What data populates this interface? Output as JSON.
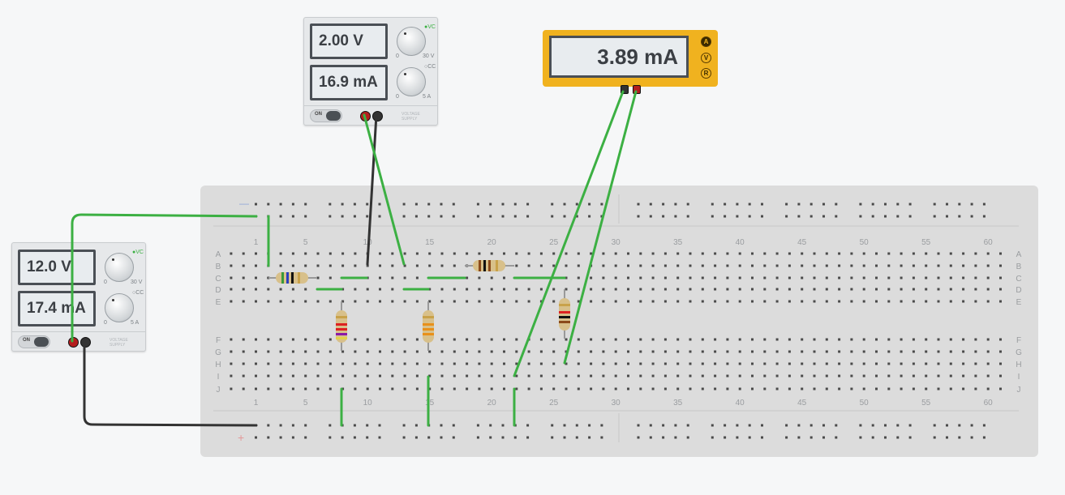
{
  "supply_top": {
    "voltage": "2.00 V",
    "current": "16.9 mA",
    "cv_label": "VC",
    "cc_label": "CC",
    "vmin": "0",
    "vmax": "30 V",
    "amin": "0",
    "amax": "5 A",
    "on_label": "ON",
    "brand": "VOLTAGE SUPPLY"
  },
  "supply_left": {
    "voltage": "12.0 V",
    "current": "17.4 mA",
    "cv_label": "VC",
    "cc_label": "CC",
    "vmin": "0",
    "vmax": "30 V",
    "amin": "0",
    "amax": "5 A",
    "on_label": "ON",
    "brand": "VOLTAGE SUPPLY"
  },
  "multimeter": {
    "reading": "3.89 mA",
    "modes": [
      "A",
      "V",
      "R"
    ],
    "active_mode": "A"
  },
  "breadboard": {
    "row_letters_top": [
      "A",
      "B",
      "C",
      "D",
      "E"
    ],
    "row_letters_bottom": [
      "F",
      "G",
      "H",
      "I",
      "J"
    ],
    "column_numbers": [
      "1",
      "5",
      "10",
      "15",
      "20",
      "25",
      "30",
      "35",
      "40",
      "45",
      "50",
      "55",
      "60"
    ],
    "rail_minus": "—",
    "rail_plus": "+"
  },
  "colors": {
    "wire_green": "#3cb043",
    "wire_black": "#333333",
    "meter_body": "#f0b21f",
    "terminal_red": "#b41e1e"
  }
}
